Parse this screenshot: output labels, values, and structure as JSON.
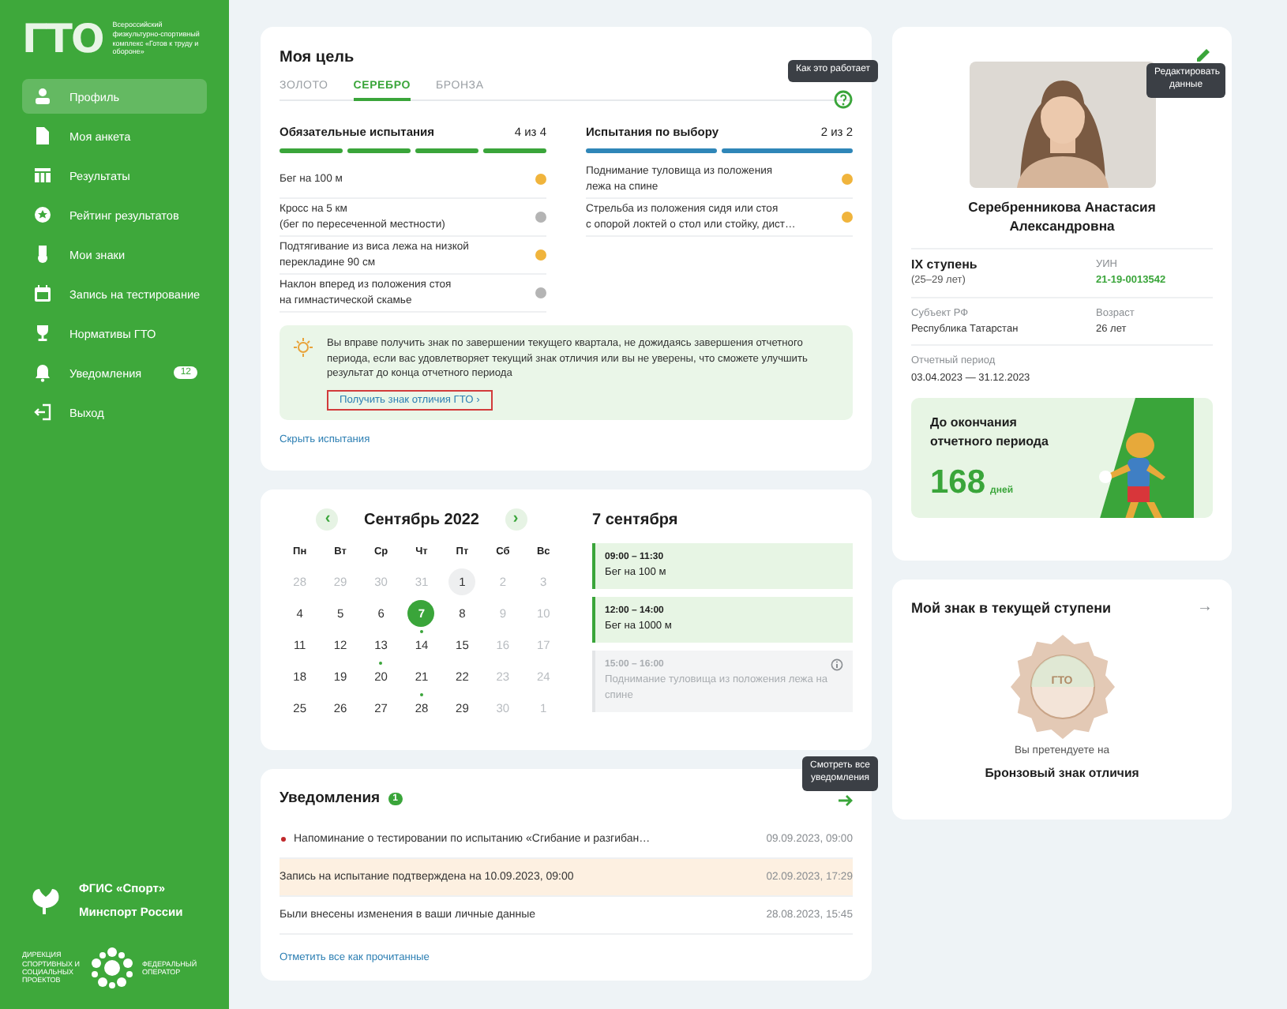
{
  "sidebar": {
    "logo_text": "ГТО",
    "logo_caption": "Всероссийский физкультурно-спортивный комплекс «Готов к труду и обороне»",
    "items": [
      {
        "label": "Профиль",
        "selected": true
      },
      {
        "label": "Моя анкета",
        "selected": false
      },
      {
        "label": "Результаты",
        "selected": false
      },
      {
        "label": "Рейтинг результатов",
        "selected": false
      },
      {
        "label": "Мои знаки",
        "selected": false
      },
      {
        "label": "Запись на тестирование",
        "selected": false
      },
      {
        "label": "Нормативы ГТО",
        "selected": false
      },
      {
        "label": "Уведомления",
        "selected": false,
        "badge": "12"
      },
      {
        "label": "Выход",
        "selected": false
      }
    ],
    "footer": {
      "org_name": "ФГИС «Спорт»",
      "ministry": "Минспорт России",
      "partner_left": "ДИРЕКЦИЯ СПОРТИВНЫХ И СОЦИАЛЬНЫХ ПРОЕКТОВ",
      "partner_right": "ФЕДЕРАЛЬНЫЙ ОПЕРАТОР"
    }
  },
  "goal": {
    "title": "Моя цель",
    "help_tooltip": "Как это работает",
    "tabs": [
      {
        "label": "ЗОЛОТО",
        "selected": false
      },
      {
        "label": "СЕРЕБРО",
        "selected": true
      },
      {
        "label": "БРОНЗА",
        "selected": false
      }
    ],
    "groups": [
      {
        "title": "Обязательные испытания",
        "count": "4 из 4",
        "color": "#3aa53a",
        "segments": [
          {
            "filled": true
          },
          {
            "filled": true
          },
          {
            "filled": true
          },
          {
            "filled": true
          }
        ],
        "tests": [
          {
            "name": "Бег на 100 м",
            "color": "#f0b43c"
          },
          {
            "name": "Кросс на 5 км\n(бег по пересеченной местности)",
            "color": "#b4b4b4"
          },
          {
            "name": "Подтягивание из виса лежа на низкой\nперекладине 90 см",
            "color": "#f0b43c"
          },
          {
            "name": "Наклон вперед из положения стоя\nна гимнастической скамье",
            "color": "#b4b4b4"
          }
        ]
      },
      {
        "title": "Испытания по выбору",
        "count": "2 из 2",
        "color": "#2f86b8",
        "segments": [
          {
            "filled": true
          },
          {
            "filled": true
          }
        ],
        "tests": [
          {
            "name": "Поднимание туловища из положения\nлежа на спине",
            "color": "#f0b43c"
          },
          {
            "name": "Стрельба из положения сидя или стоя\nс опорой локтей о стол или стойку, дист…",
            "color": "#f0b43c"
          }
        ]
      }
    ],
    "hint": {
      "text": "Вы вправе получить знак по завершении текущего квартала, не дожидаясь завершения отчетного периода, если вас  удовлетворяет текущий знак отличия или вы не уверены, что сможете улучшить результат до конца отчетного периода",
      "link": "Получить знак отличия ГТО  ›"
    },
    "hide_link": "Скрыть испытания"
  },
  "calendar": {
    "prev": "‹",
    "month": "Сентябрь 2022",
    "next": "›",
    "weekdays": [
      "Пн",
      "Вт",
      "Ср",
      "Чт",
      "Пт",
      "Сб",
      "Вс"
    ],
    "days": [
      {
        "day": "28",
        "muted": true
      },
      {
        "day": "29",
        "muted": true
      },
      {
        "day": "30",
        "muted": true
      },
      {
        "day": "31",
        "muted": true
      },
      {
        "day": "1",
        "muted": false,
        "today": true
      },
      {
        "day": "2",
        "muted": true
      },
      {
        "day": "3",
        "muted": true
      },
      {
        "day": "4",
        "muted": false
      },
      {
        "day": "5",
        "muted": false
      },
      {
        "day": "6",
        "muted": false
      },
      {
        "day": "7",
        "muted": false,
        "selected": true,
        "event": true
      },
      {
        "day": "8",
        "muted": false
      },
      {
        "day": "9",
        "muted": true
      },
      {
        "day": "10",
        "muted": true
      },
      {
        "day": "11",
        "muted": false
      },
      {
        "day": "12",
        "muted": false
      },
      {
        "day": "13",
        "muted": false,
        "event": true
      },
      {
        "day": "14",
        "muted": false
      },
      {
        "day": "15",
        "muted": false
      },
      {
        "day": "16",
        "muted": true
      },
      {
        "day": "17",
        "muted": true
      },
      {
        "day": "18",
        "muted": false
      },
      {
        "day": "19",
        "muted": false
      },
      {
        "day": "20",
        "muted": false
      },
      {
        "day": "21",
        "muted": false,
        "event": true
      },
      {
        "day": "22",
        "muted": false
      },
      {
        "day": "23",
        "muted": true
      },
      {
        "day": "24",
        "muted": true
      },
      {
        "day": "25",
        "muted": false
      },
      {
        "day": "26",
        "muted": false
      },
      {
        "day": "27",
        "muted": false
      },
      {
        "day": "28",
        "muted": false
      },
      {
        "day": "29",
        "muted": false
      },
      {
        "day": "30",
        "muted": true
      },
      {
        "day": "1",
        "muted": true
      }
    ],
    "date_title": "7 сентября",
    "events": [
      {
        "time": "09:00 – 11:30",
        "name": "Бег на 100 м",
        "disabled": false
      },
      {
        "time": "12:00 – 14:00",
        "name": "Бег на 1000 м",
        "disabled": false
      },
      {
        "time": "15:00 – 16:00",
        "name": "Поднимание туловища из положения лежа на спине",
        "disabled": true
      }
    ]
  },
  "notifications": {
    "title": "Уведомления",
    "count": "1",
    "tooltip": "Смотреть все уведомления",
    "items": [
      {
        "text": "Напоминание о тестировании по испытанию «Сгибание и разгибан…",
        "time": "09.09.2023, 09:00",
        "unread": true,
        "highlighted": false
      },
      {
        "text": "Запись на испытание подтверждена на 10.09.2023, 09:00",
        "time": "02.09.2023, 17:29",
        "unread": false,
        "highlighted": true
      },
      {
        "text": "Были внесены изменения в ваши личные данные",
        "time": "28.08.2023, 15:45",
        "unread": false,
        "highlighted": false
      }
    ],
    "mark_all": "Отметить все как прочитанные"
  },
  "profile": {
    "edit_tooltip": "Редактировать данные",
    "name": "Серебренникова Анастасия Александровна",
    "fields": [
      {
        "label": "IX ступень",
        "value": "(25–29 лет)",
        "kind": "title"
      },
      {
        "label": "УИН",
        "value": "21-19-0013542",
        "kind": "accent"
      },
      {
        "label": "Субъект РФ",
        "value": "Республика Татарстан",
        "kind": "plain"
      },
      {
        "label": "Возраст",
        "value": "26 лет",
        "kind": "plain"
      },
      {
        "label": "Отчетный период",
        "value": "03.04.2023 — 31.12.2023",
        "kind": "plain"
      }
    ],
    "countdown": {
      "title": "До окончания отчетного периода",
      "number": "168",
      "unit": "дней"
    }
  },
  "badge_card": {
    "title": "Мой знак в текущей ступени",
    "arrow": "→",
    "badge_label": "ГТО",
    "caption": "Вы претендуете на",
    "badge_name": "Бронзовый знак отличия"
  }
}
